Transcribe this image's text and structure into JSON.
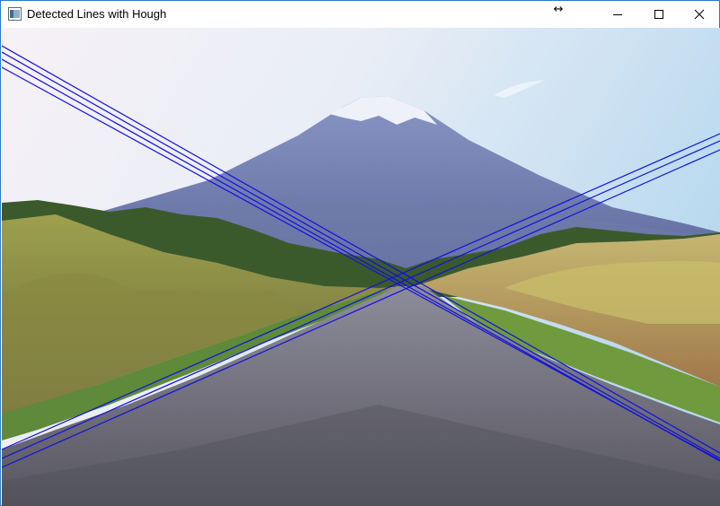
{
  "window": {
    "title": "Detected Lines with Hough",
    "controls": {
      "minimize_icon": "minimize-icon",
      "maximize_icon": "maximize-icon",
      "close_icon": "close-icon"
    },
    "resize_cursor": "↔"
  },
  "image": {
    "watermark": "",
    "description_icons": [
      "mountain",
      "road",
      "trees",
      "sky"
    ],
    "detected_lines_color": "#0000ff"
  },
  "colors": {
    "window_border": "#2b79c6",
    "titlebar_bg": "#ffffff",
    "line_color": "#1010e0"
  }
}
